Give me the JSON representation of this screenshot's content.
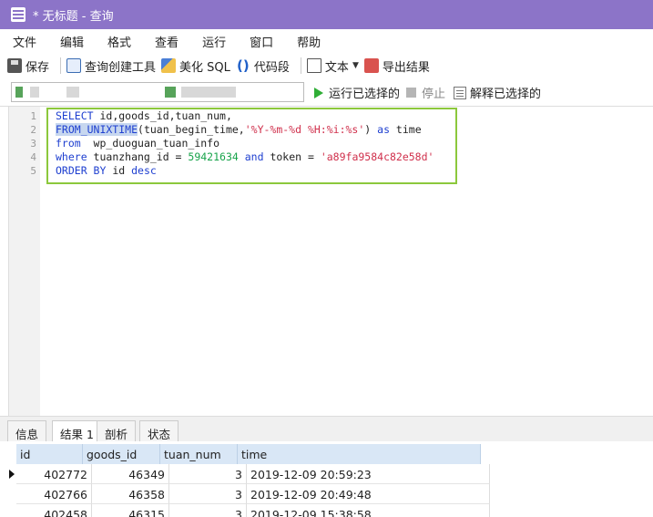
{
  "window": {
    "title": "* 无标题 - 查询"
  },
  "menu": [
    "文件",
    "编辑",
    "格式",
    "查看",
    "运行",
    "窗口",
    "帮助"
  ],
  "toolbar": {
    "save": "保存",
    "query_builder": "查询创建工具",
    "beautify": "美化 SQL",
    "code_snippet": "代码段",
    "text": "文本",
    "export": "导出结果"
  },
  "conn_bar": {
    "run_selected": "运行已选择的",
    "stop": "停止",
    "explain_selected": "解释已选择的"
  },
  "editor": {
    "line_numbers": [
      "1",
      "2",
      "3",
      "4",
      "5"
    ],
    "lines": [
      {
        "kw1": "SELECT",
        "rest": " id,goods_id,tuan_num,"
      },
      {
        "fn": "FROM_UNIXTIME",
        "p1": "(tuan_begin_time,",
        "str": "'%Y-%m-%d %H:%i:%s'",
        "p2": ") ",
        "kw": "as",
        "p3": " time"
      },
      {
        "kw": "from",
        "rest": "  wp_duoguan_tuan_info"
      },
      {
        "kw": "where",
        "p1": " tuanzhang_id = ",
        "num": "59421634",
        "p2": " ",
        "kw2": "and",
        "p3": " token = ",
        "str": "'a89fa9584c82e58d'"
      },
      {
        "kw": "ORDER BY",
        "p1": " id ",
        "kw2": "desc"
      }
    ]
  },
  "tabs": [
    "信息",
    "结果 1",
    "剖析",
    "状态"
  ],
  "results": {
    "columns": [
      "id",
      "goods_id",
      "tuan_num",
      "time"
    ],
    "rows": [
      [
        "402772",
        "46349",
        "3",
        "2019-12-09 20:59:23"
      ],
      [
        "402766",
        "46358",
        "3",
        "2019-12-09 20:49:48"
      ],
      [
        "402458",
        "46315",
        "3",
        "2019-12-09 15:38:58"
      ]
    ]
  },
  "colors": {
    "titlebar": "#8c74c8",
    "highlight_box": "#8cc83c",
    "keyword": "#1e3fd0",
    "string": "#d0304c",
    "number": "#17a34a"
  }
}
